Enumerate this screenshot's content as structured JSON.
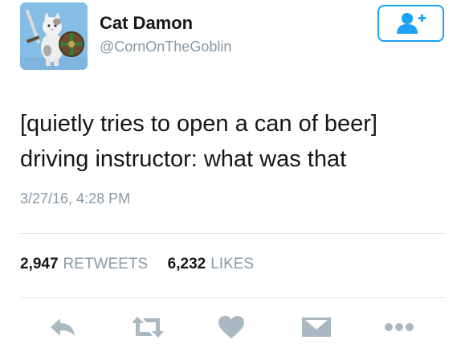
{
  "user": {
    "display_name": "Cat Damon",
    "screen_name": "@CornOnTheGoblin"
  },
  "tweet": {
    "lines": [
      "[quietly tries to open a can of beer]",
      "driving instructor: what was that"
    ],
    "timestamp": "3/27/16, 4:28 PM"
  },
  "stats": {
    "retweets_count": "2,947",
    "retweets_label": "RETWEETS",
    "likes_count": "6,232",
    "likes_label": "LIKES"
  },
  "actions": {
    "reply_icon": "reply-icon",
    "retweet_icon": "retweet-icon",
    "like_icon": "heart-icon",
    "dm_icon": "envelope-icon",
    "more_icon": "more-dots-icon"
  },
  "colors": {
    "accent": "#1da1f2",
    "icon_gray": "#aab8c2",
    "secondary_text": "#8899a6",
    "primary_text": "#14171a"
  }
}
